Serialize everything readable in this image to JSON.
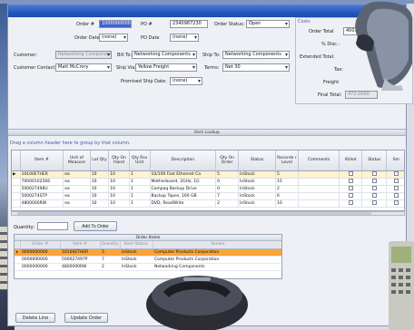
{
  "order": {
    "order_no_label": "Order #",
    "order_no_value": "1000000000",
    "po_no_label": "PO #",
    "po_no_value": "2340987230",
    "status_label": "Order Status:",
    "status_value": "Open",
    "order_date_label": "Order Date",
    "order_date_value": "(none)",
    "po_date_label": "PO Date",
    "po_date_value": "(none)",
    "customer_label": "Customer:",
    "customer_value": "Networking Components",
    "bill_to_label": "Bill To:",
    "bill_to_value": "Networking Components",
    "ship_to_label": "Ship To:",
    "ship_to_value": "Networking Components",
    "contact_label": "Customer Contact:",
    "contact_value": "Matt McCrory",
    "ship_via_label": "Ship Via:",
    "ship_via_value": "Yellow Freight",
    "terms_label": "Terms:",
    "terms_value": "Net 30",
    "promised_label": "Promised Ship Date:",
    "promised_value": "(none)"
  },
  "costs": {
    "title": "Costs",
    "order_total_label": "Order Total",
    "order_total_value": "400.0000",
    "disc_label": "% Disc.:",
    "disc_value": "0",
    "extended_label": "Extended Total:",
    "tax_label": "Tax:",
    "freight_label": "Freight",
    "final_label": "Final Total:",
    "final_value": "472.0000"
  },
  "lookup": {
    "title": "Item Lookup",
    "group_hint": "Drag a column header here to group by that column.",
    "columns": [
      "Item #",
      "Unit of Measure",
      "Lot Qty",
      "Qty On Hand",
      "Qty Rsv Unit",
      "Description",
      "Qty On Order",
      "Status",
      "Recorde r Level",
      "Comments",
      "Killed",
      "Status",
      "Sm"
    ],
    "rows": [
      [
        "10100ETHER",
        "ea",
        "10",
        "10",
        "1",
        "10/100 Fast Ethernet Ca",
        "5",
        "InStock",
        "5"
      ],
      [
        "70000102566",
        "ea",
        "10",
        "10",
        "1",
        "Motherboard, 2GHz, 1G",
        "0",
        "InStock",
        "15"
      ],
      [
        "500027498U",
        "ea",
        "10",
        "10",
        "1",
        "Compaq Backup Drive",
        "0",
        "InStock",
        "2"
      ],
      [
        "5000274STP",
        "ea",
        "10",
        "10",
        "1",
        "Backup Tapes, 160 GB",
        "7",
        "InStock",
        "6"
      ],
      [
        "4800000RW",
        "ea",
        "10",
        "10",
        "1",
        "DVD, ReadWrite",
        "2",
        "InStock",
        "10"
      ]
    ]
  },
  "quantity": {
    "label": "Quantity:",
    "add_label": "Add To Order"
  },
  "order_items": {
    "title": "Order Items",
    "columns": [
      "Order #",
      "Item #",
      "Quantity",
      "Item Status",
      "Vendor"
    ],
    "rows": [
      [
        "0000000000",
        "10100ETHER",
        "5",
        "InStock",
        "Computer Products Corporation"
      ],
      [
        "0000000000",
        "500027497P",
        "7",
        "InStock",
        "Computer Products Corporation"
      ],
      [
        "0000000000",
        "4800000RW",
        "2",
        "InStock",
        "Networking Components"
      ]
    ]
  },
  "actions": {
    "delete_label": "Delete Line",
    "update_label": "Update Order"
  },
  "colors": {
    "titlebar": "#2459c2",
    "selected_row": "#f8a43a",
    "highlight": "#3d63c8"
  }
}
